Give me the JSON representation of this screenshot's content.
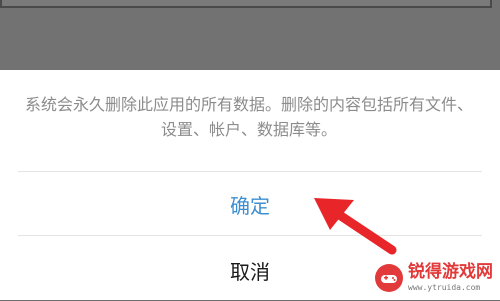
{
  "dialog": {
    "message": "系统会永久删除此应用的所有数据。删除的内容包括所有文件、设置、帐户、数据库等。",
    "confirm_label": "确定",
    "cancel_label": "取消"
  },
  "colors": {
    "confirm": "#3e8fd1",
    "cancel": "#1a1a1a",
    "message": "#8c8c8c",
    "arrow": "#e8262a",
    "overlay": "#6f6f6f"
  },
  "watermark": {
    "title": "锐得游戏网",
    "url": "www.ytruida.com"
  }
}
